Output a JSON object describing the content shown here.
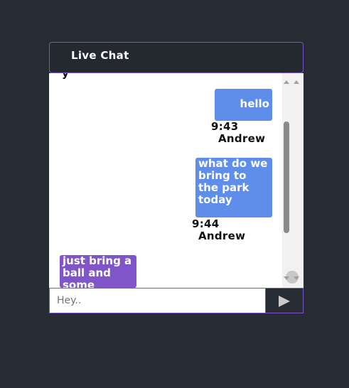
{
  "header": {
    "title": "Live Chat"
  },
  "messages": [
    {
      "text": "hello",
      "time": "9:43",
      "author": "Andrew",
      "color": "#5e8eea",
      "side": "right"
    },
    {
      "text": "what do we bring to the park today",
      "time": "9:44",
      "author": "Andrew",
      "color": "#5e8eea",
      "side": "right"
    },
    {
      "text": "just bring a ball and some",
      "color": "#7f55c8",
      "side": "left"
    }
  ],
  "input": {
    "placeholder": "Hey..",
    "value": ""
  },
  "icons": {
    "send": "send-icon"
  },
  "colors": {
    "page_bg": "#272b34",
    "header_bg": "#23292f",
    "accent_border": "#7b57c9",
    "outgoing_bubble": "#5e8eea",
    "incoming_bubble": "#7f55c8"
  }
}
